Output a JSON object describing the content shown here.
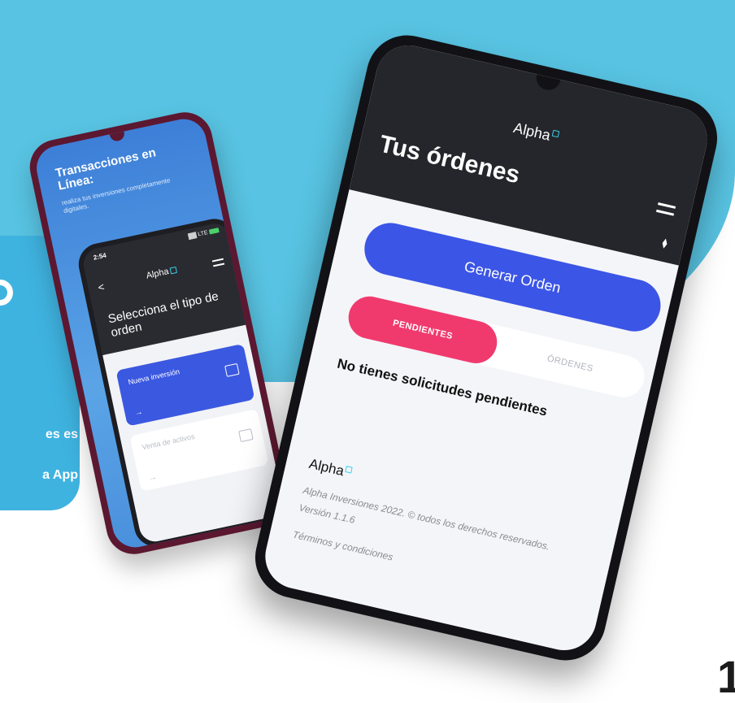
{
  "promo": {
    "line1": "es es",
    "line2": "a App",
    "corner": "1"
  },
  "small_phone": {
    "title": "Transacciones en Línea:",
    "subtitle": "realiza tus inversiones completamente digitales.",
    "inner": {
      "time": "2:54",
      "signal": "▓▓ LTE",
      "back": "<",
      "logo": "Alpha",
      "heading": "Selecciona el tipo de orden",
      "card1": {
        "title": "Nueva inversión",
        "arrow": "→"
      },
      "card2": {
        "title": "Venta de activos",
        "arrow": "→"
      }
    }
  },
  "large_phone": {
    "logo": "Alpha",
    "title": "Tus órdenes",
    "filter_icon": "⧫",
    "generate_button": "Generar Orden",
    "tabs": {
      "active": "PENDIENTES",
      "other": "ÓRDENES"
    },
    "empty_message": "No tienes solicitudes pendientes",
    "footer_logo": "Alpha",
    "footer_text": "Alpha Inversiones 2022. © todos los derechos reservados. Versión 1.1.6",
    "terms": "Términos y condiciones"
  },
  "colors": {
    "sky": "#58c3e2",
    "card": "#3fb3e0",
    "brand_blue": "#3b55e6",
    "pink": "#f03a6e",
    "dark": "#25262b"
  }
}
